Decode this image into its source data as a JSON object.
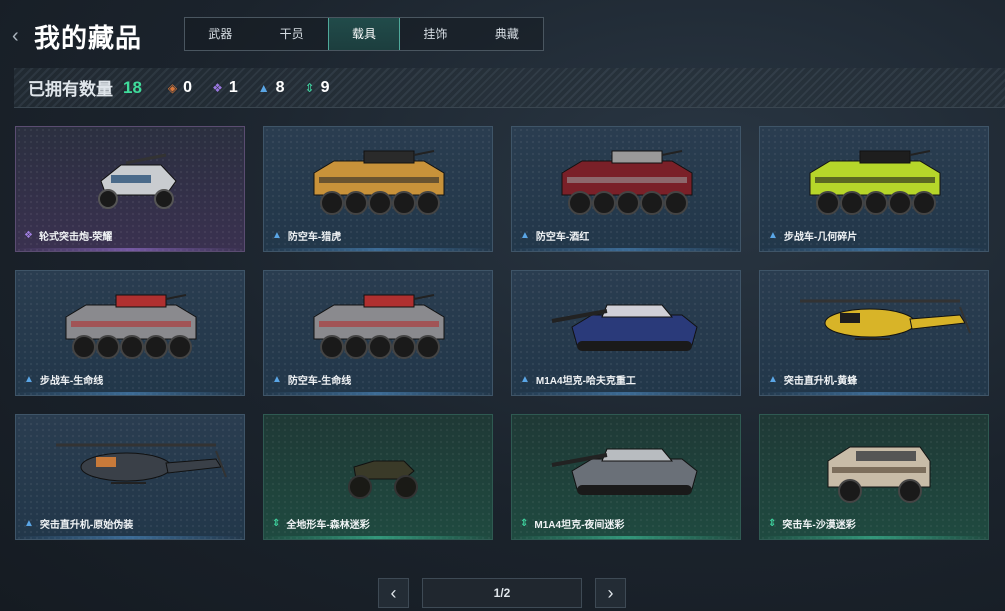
{
  "header": {
    "title": "我的藏品",
    "tabs": [
      {
        "label": "武器",
        "active": false
      },
      {
        "label": "干员",
        "active": false
      },
      {
        "label": "载具",
        "active": true
      },
      {
        "label": "挂饰",
        "active": false
      },
      {
        "label": "典藏",
        "active": false
      }
    ]
  },
  "stats": {
    "label": "已拥有数量",
    "total": "18",
    "items": [
      {
        "icon": "orange-diamond-icon",
        "color": "#d9773a",
        "count": "0"
      },
      {
        "icon": "purple-diamond-icon",
        "color": "#9a78e0",
        "count": "1"
      },
      {
        "icon": "blue-chevron-icon",
        "color": "#5aa6e6",
        "count": "8"
      },
      {
        "icon": "green-arrows-icon",
        "color": "#3fd39f",
        "count": "9"
      }
    ]
  },
  "items": [
    {
      "name": "轮式突击炮-荣耀",
      "rarity": "purple",
      "vehicle": "buggy",
      "colors": [
        "#c9ccd0",
        "#4a6a8a"
      ]
    },
    {
      "name": "防空车-猎虎",
      "rarity": "blue",
      "vehicle": "apc",
      "colors": [
        "#c8923a",
        "#2a2a2a"
      ]
    },
    {
      "name": "防空车-酒红",
      "rarity": "blue",
      "vehicle": "apc",
      "colors": [
        "#7a2028",
        "#9a9a9a"
      ]
    },
    {
      "name": "步战车-几何碎片",
      "rarity": "blue",
      "vehicle": "apc",
      "colors": [
        "#b6d62a",
        "#1e1e1e"
      ]
    },
    {
      "name": "步战车-生命线",
      "rarity": "blue",
      "vehicle": "apc",
      "colors": [
        "#8a8a8e",
        "#b03030"
      ]
    },
    {
      "name": "防空车-生命线",
      "rarity": "blue",
      "vehicle": "apc",
      "colors": [
        "#8a8a8e",
        "#b03030"
      ]
    },
    {
      "name": "M1A4坦克-哈夫克重工",
      "rarity": "blue",
      "vehicle": "tank",
      "colors": [
        "#2a3a7a",
        "#d0d0d8"
      ]
    },
    {
      "name": "突击直升机-黄蜂",
      "rarity": "blue",
      "vehicle": "heli",
      "colors": [
        "#d8b428",
        "#1e1e1e"
      ]
    },
    {
      "name": "突击直升机-原始伪装",
      "rarity": "blue",
      "vehicle": "heli",
      "colors": [
        "#3a4048",
        "#c87a3a"
      ]
    },
    {
      "name": "全地形车-森林迷彩",
      "rarity": "green",
      "vehicle": "atv",
      "colors": [
        "#3a3a28",
        "#1a1a16"
      ]
    },
    {
      "name": "M1A4坦克-夜间迷彩",
      "rarity": "green",
      "vehicle": "tank",
      "colors": [
        "#6a7078",
        "#b8bcc0"
      ]
    },
    {
      "name": "突击车-沙漠迷彩",
      "rarity": "green",
      "vehicle": "truck",
      "colors": [
        "#c8bca8",
        "#4a3a2a"
      ]
    }
  ],
  "pagination": {
    "prev_icon": "chevron-left-icon",
    "next_icon": "chevron-right-icon",
    "page": "1/2"
  }
}
